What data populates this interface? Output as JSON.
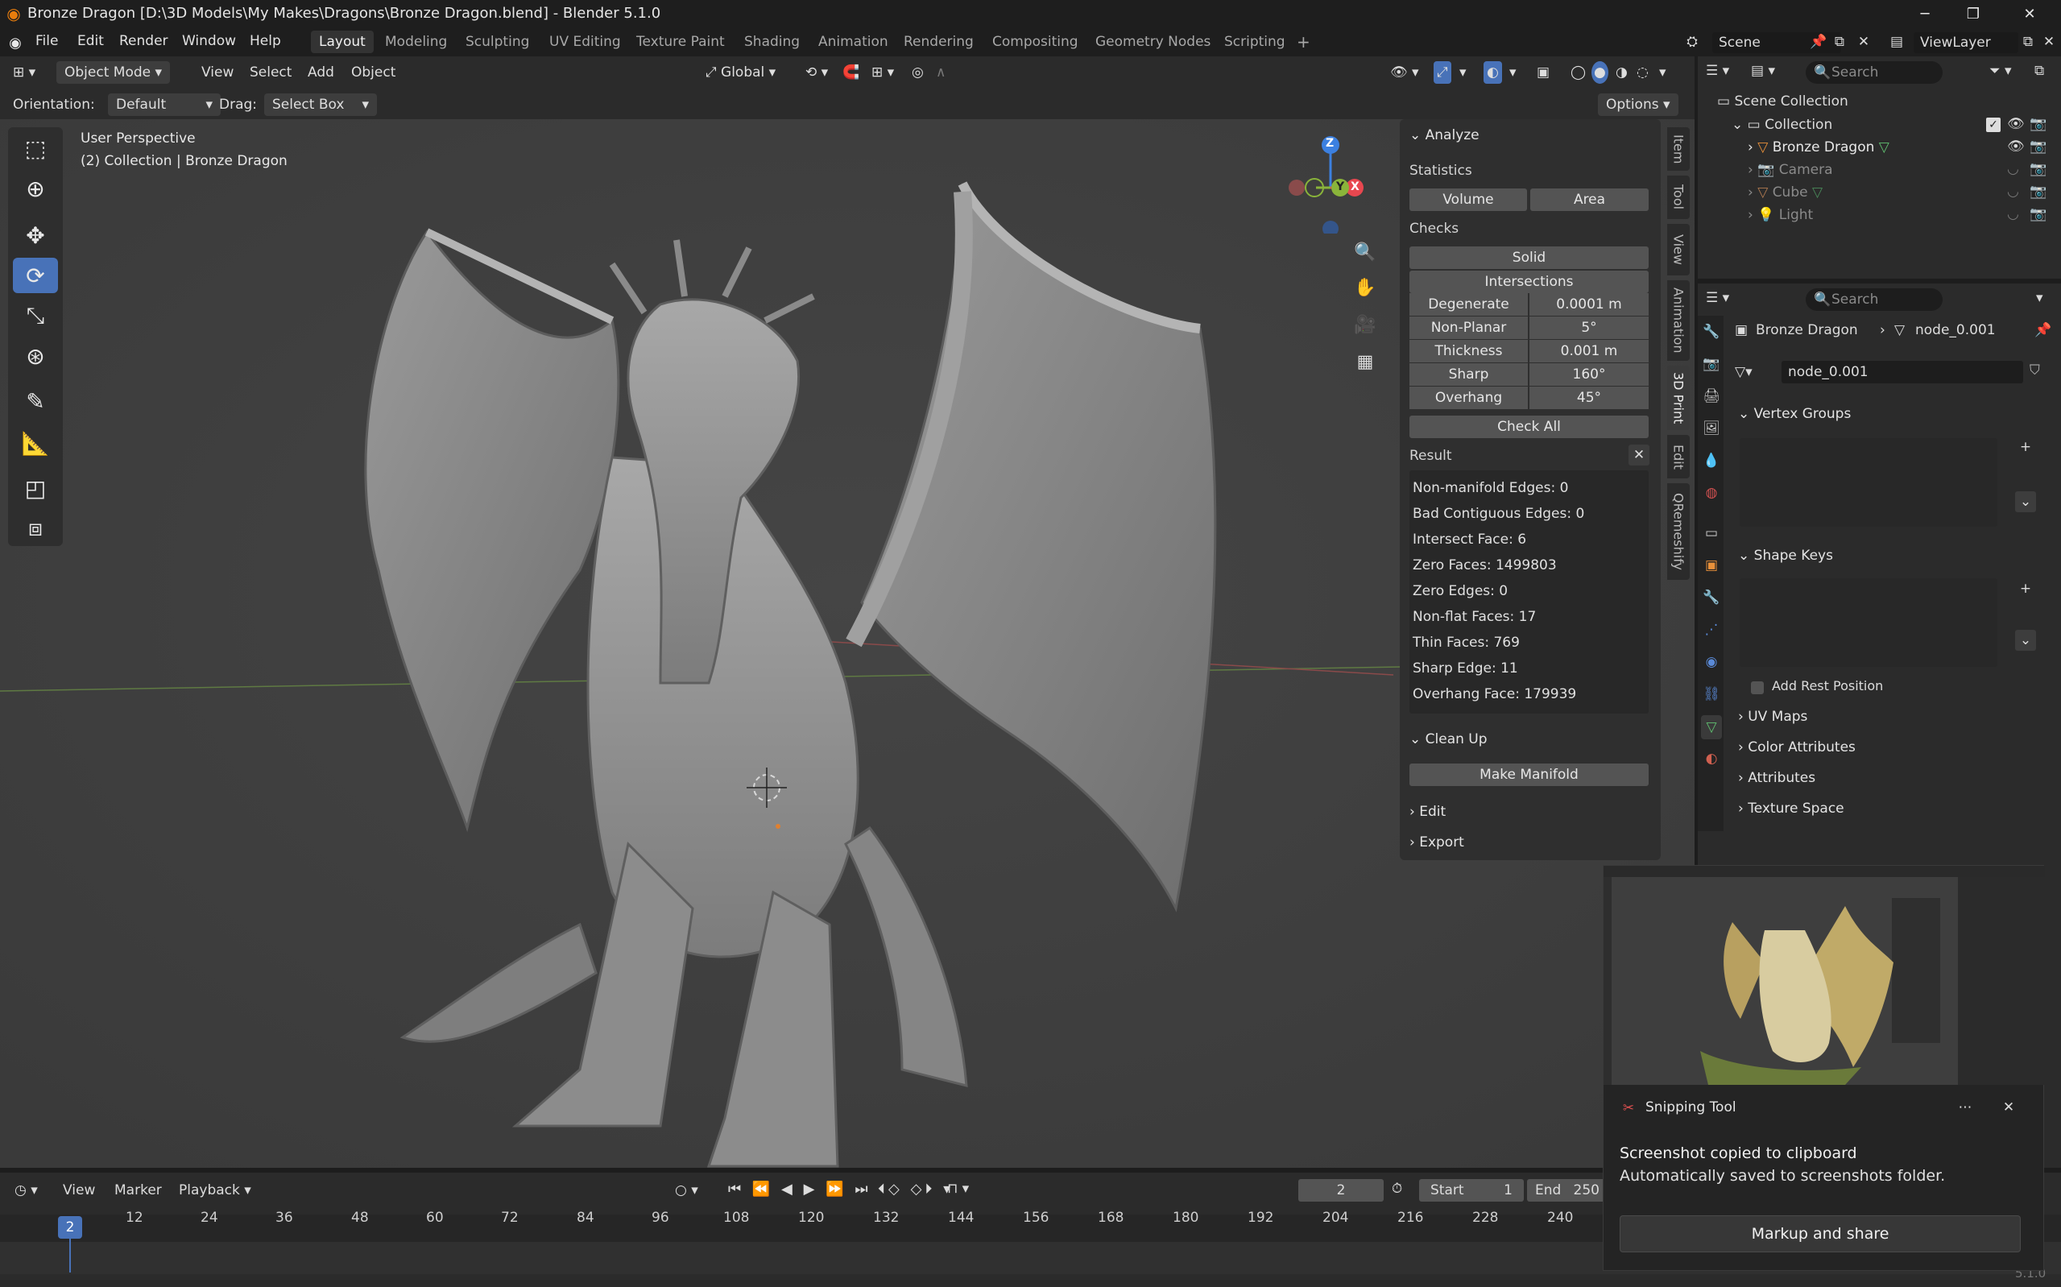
{
  "titlebar": {
    "title": "Bronze Dragon [D:\\3D Models\\My Makes\\Dragons\\Bronze Dragon.blend] - Blender 5.1.0"
  },
  "menu": [
    "File",
    "Edit",
    "Render",
    "Window",
    "Help"
  ],
  "workspaces": [
    "Layout",
    "Modeling",
    "Sculpting",
    "UV Editing",
    "Texture Paint",
    "Shading",
    "Animation",
    "Rendering",
    "Compositing",
    "Geometry Nodes",
    "Scripting"
  ],
  "scene": {
    "label": "Scene",
    "viewlayer": "ViewLayer"
  },
  "viewport_header": {
    "mode": "Object Mode",
    "menus": [
      "View",
      "Select",
      "Add",
      "Object"
    ],
    "transform": "Global",
    "orientation_label": "Orientation:",
    "orientation_value": "Default",
    "drag_label": "Drag:",
    "drag_value": "Select Box",
    "options": "Options"
  },
  "overlay_text": {
    "perspective": "User Perspective",
    "collection": "(2) Collection | Bronze Dragon"
  },
  "gizmo": {
    "z": "Z",
    "y": "Y",
    "x": "X"
  },
  "npanel": {
    "analyze": "Analyze",
    "statistics": "Statistics",
    "volume": "Volume",
    "area": "Area",
    "checks": "Checks",
    "solid": "Solid",
    "intersections": "Intersections",
    "props": [
      {
        "k": "Degenerate",
        "v": "0.0001 m"
      },
      {
        "k": "Non-Planar",
        "v": "5°"
      },
      {
        "k": "Thickness",
        "v": "0.001 m"
      },
      {
        "k": "Sharp",
        "v": "160°"
      },
      {
        "k": "Overhang",
        "v": "45°"
      }
    ],
    "check_all": "Check All",
    "result": "Result",
    "results": [
      "Non-manifold Edges: 0",
      "Bad Contiguous Edges: 0",
      "Intersect Face: 6",
      "Zero Faces: 1499803",
      "Zero Edges: 0",
      "Non-flat Faces: 17",
      "Thin Faces: 769",
      "Sharp Edge: 11",
      "Overhang Face: 179939"
    ],
    "clean_up": "Clean Up",
    "make_manifold": "Make Manifold",
    "edit": "Edit",
    "export": "Export"
  },
  "vtabs": [
    "Item",
    "Tool",
    "View",
    "Animation",
    "3D Print",
    "Edit",
    "QRemeshify"
  ],
  "outliner": {
    "search": "Search",
    "scene_collection": "Scene Collection",
    "collection": "Collection",
    "items": [
      "Bronze Dragon",
      "Camera",
      "Cube",
      "Light"
    ]
  },
  "properties": {
    "search": "Search",
    "breadcrumb_obj": "Bronze Dragon",
    "breadcrumb_data": "node_0.001",
    "data_name": "node_0.001",
    "vertex_groups": "Vertex Groups",
    "shape_keys": "Shape Keys",
    "add_rest_position": "Add Rest Position",
    "uv_maps": "UV Maps",
    "color_attributes": "Color Attributes",
    "attributes": "Attributes",
    "texture_space": "Texture Space"
  },
  "timeline": {
    "menus": [
      "View",
      "Marker",
      "Playback"
    ],
    "current_frame": "2",
    "start_label": "Start",
    "start": "1",
    "end_label": "End",
    "end": "250",
    "playhead": "2",
    "ticks": [
      "12",
      "24",
      "36",
      "48",
      "60",
      "72",
      "84",
      "96",
      "108",
      "120",
      "132",
      "144",
      "156",
      "168",
      "180",
      "192",
      "204",
      "216",
      "228",
      "240"
    ]
  },
  "snipping": {
    "app": "Snipping Tool",
    "line1": "Screenshot copied to clipboard",
    "line2": "Automatically saved to screenshots folder.",
    "button": "Markup and share"
  },
  "version": "5.1.0",
  "colors": {
    "accent": "#4872b8",
    "axis_x": "#e8474f",
    "axis_y": "#8ab43a",
    "axis_z": "#3c80e0"
  }
}
